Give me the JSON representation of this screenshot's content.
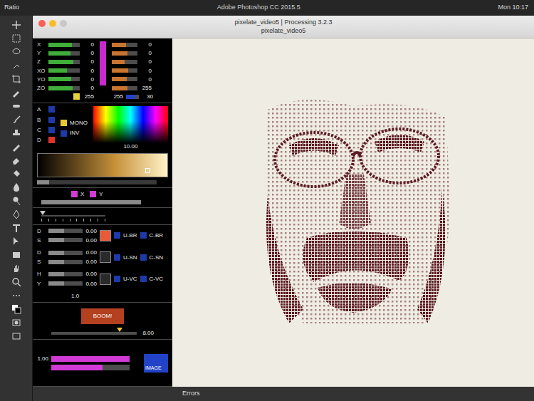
{
  "menubar": {
    "panel_label": "Ratio",
    "app_title": "Adobe Photoshop CC 2015.5",
    "clock": "Mon 10:17"
  },
  "window": {
    "title": "pixelate_video5 | Processing 3.2.3",
    "subtitle": "pixelate_video5"
  },
  "xyz": {
    "sliders": [
      {
        "label": "X",
        "level": 0.75,
        "reading": "0"
      },
      {
        "label": "Y",
        "level": 0.7,
        "reading": "0"
      },
      {
        "label": "Z",
        "level": 0.8,
        "reading": "0"
      },
      {
        "label": "XO",
        "level": 0.6,
        "reading": "0"
      },
      {
        "label": "YO",
        "level": 0.72,
        "reading": "0"
      },
      {
        "label": "ZO",
        "level": 0.78,
        "reading": "0"
      }
    ],
    "footer_reading": "255",
    "magenta_level": 1.0
  },
  "rgb": {
    "sliders": [
      {
        "level": 0.55,
        "reading": "0"
      },
      {
        "level": 0.6,
        "reading": "0"
      },
      {
        "level": 0.5,
        "reading": "0"
      },
      {
        "level": 0.65,
        "reading": "0"
      },
      {
        "level": 0.58,
        "reading": "0"
      },
      {
        "level": 0.62,
        "reading": "255"
      }
    ],
    "footer_reading": "255",
    "alpha": {
      "level": 0.7,
      "reading": "30"
    }
  },
  "modes": [
    {
      "label": "A",
      "on": false
    },
    {
      "label": "B",
      "on": false
    },
    {
      "label": "C",
      "on": false
    },
    {
      "label": "D",
      "on": true
    }
  ],
  "toggles": [
    {
      "label": "MONO",
      "on": true
    },
    {
      "label": "INV",
      "on": false
    }
  ],
  "spectrum": {
    "reading": "10.00"
  },
  "gold_picker": {
    "level": 0.85
  },
  "gold_slider": {
    "level": 0.1
  },
  "xy": {
    "toggles": [
      {
        "label": "X",
        "on": true
      },
      {
        "label": "Y",
        "on": true
      }
    ],
    "level": 1.0
  },
  "tick_slider": {
    "level": 0.02
  },
  "effects": [
    {
      "labels": [
        "D",
        "S"
      ],
      "readings": [
        "0.00",
        "0.00"
      ],
      "levels": [
        0.45,
        0.45
      ],
      "active": true,
      "buttons": [
        {
          "label": "U-BR",
          "on": false
        },
        {
          "label": "C-BR",
          "on": false
        }
      ]
    },
    {
      "labels": [
        "D",
        "S"
      ],
      "readings": [
        "0.00",
        "0.00"
      ],
      "levels": [
        0.45,
        0.45
      ],
      "active": false,
      "buttons": [
        {
          "label": "U-SN",
          "on": false
        },
        {
          "label": "C-SN",
          "on": false
        }
      ]
    },
    {
      "labels": [
        "H",
        "Y"
      ],
      "readings": [
        "0.00",
        "0.00"
      ],
      "levels": [
        0.45,
        0.45
      ],
      "active": false,
      "buttons": [
        {
          "label": "U-VC",
          "on": false
        },
        {
          "label": "C-VC",
          "on": false
        }
      ]
    }
  ],
  "effects_reading": "1.0",
  "boom": {
    "label": "BOOM!",
    "level": 0.8,
    "reading": "8.00"
  },
  "image": {
    "reading": "1.00",
    "levels": [
      1.0,
      0.65
    ],
    "label": "IMAGE"
  },
  "console": {
    "tab": "Errors"
  }
}
